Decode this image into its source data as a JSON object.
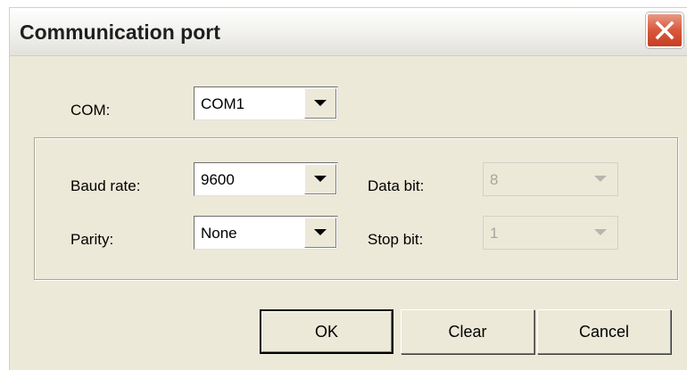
{
  "window": {
    "title": "Communication port"
  },
  "com": {
    "label": "COM:",
    "value": "COM1"
  },
  "settings": {
    "baud_rate": {
      "label": "Baud rate:",
      "value": "9600"
    },
    "parity": {
      "label": "Parity:",
      "value": "None"
    },
    "data_bit": {
      "label": "Data bit:",
      "value": "8",
      "enabled": false
    },
    "stop_bit": {
      "label": "Stop bit:",
      "value": "1",
      "enabled": false
    }
  },
  "buttons": {
    "ok": "OK",
    "clear": "Clear",
    "cancel": "Cancel"
  },
  "icons": {
    "close": "close-icon",
    "dropdown": "chevron-down-icon"
  },
  "colors": {
    "dialog_bg": "#ece9d8",
    "close_red": "#d9573b"
  }
}
